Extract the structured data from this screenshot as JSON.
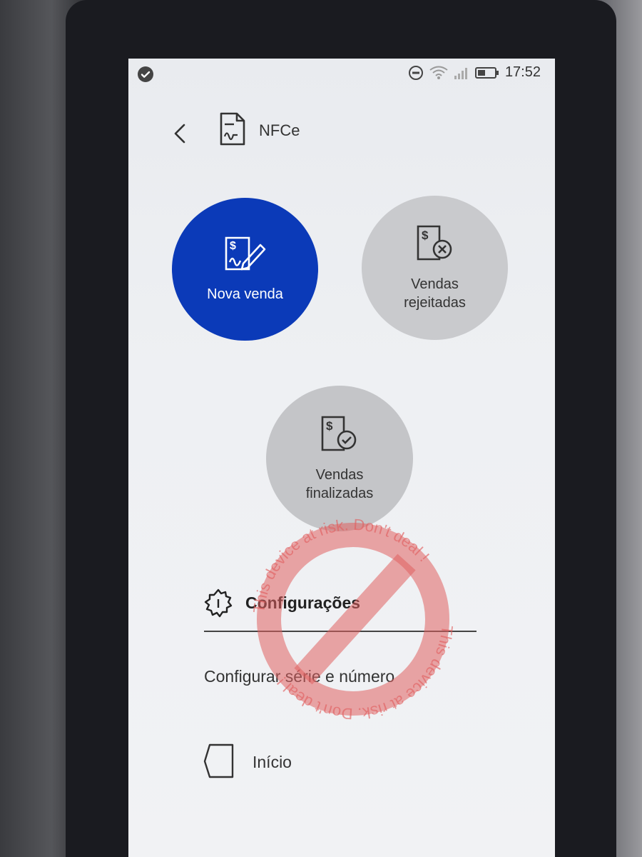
{
  "status": {
    "time": "17:52"
  },
  "header": {
    "title": "NFCe"
  },
  "actions": {
    "nova_venda": "Nova venda",
    "vendas_rejeitadas_line1": "Vendas",
    "vendas_rejeitadas_line2": "rejeitadas",
    "vendas_finalizadas_line1": "Vendas",
    "vendas_finalizadas_line2": "finalizadas"
  },
  "menu": {
    "configuracoes": "Configurações",
    "configurar_serie": "Configurar série e número",
    "inicio": "Início"
  },
  "watermark": {
    "text_top": "This device at risk. Don't deal !",
    "text_bottom": "This device at risk. Don't deal !"
  },
  "colors": {
    "primary_blue": "#0b3ab8",
    "circle_grey": "#c9cacd",
    "watermark_red": "#e06060"
  }
}
